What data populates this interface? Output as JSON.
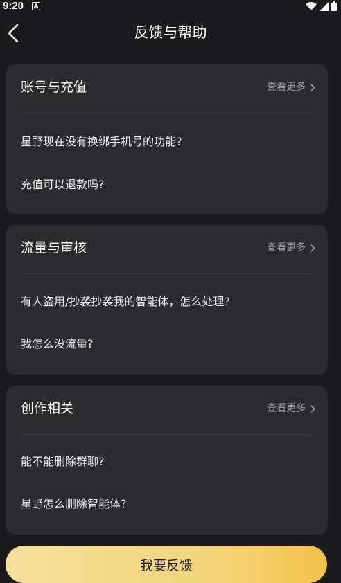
{
  "status_bar": {
    "time": "9:20"
  },
  "header": {
    "title": "反馈与帮助"
  },
  "sections": [
    {
      "title": "账号与充值",
      "more_label": "查看更多",
      "questions": [
        "星野现在没有换绑手机号的功能?",
        "充值可以退款吗?"
      ]
    },
    {
      "title": "流量与审核",
      "more_label": "查看更多",
      "questions": [
        "有人盗用/抄袭抄袭我的智能体，怎么处理?",
        "我怎么没流量?"
      ]
    },
    {
      "title": "创作相关",
      "more_label": "查看更多",
      "questions": [
        "能不能删除群聊?",
        "星野怎么删除智能体?"
      ]
    }
  ],
  "footer": {
    "feedback_button_label": "我要反馈"
  },
  "icons": {
    "back": "chevron-left-icon",
    "more": "chevron-right-icon",
    "wifi": "wifi-icon",
    "signal": "signal-icon",
    "battery": "battery-icon",
    "notification": "notification-a-icon"
  },
  "colors": {
    "background": "#1b1b1d",
    "card": "#2b2b2e",
    "muted_text": "#a0a0a4",
    "button_gradient_start": "#f6e09c",
    "button_gradient_end": "#f1c24a"
  }
}
